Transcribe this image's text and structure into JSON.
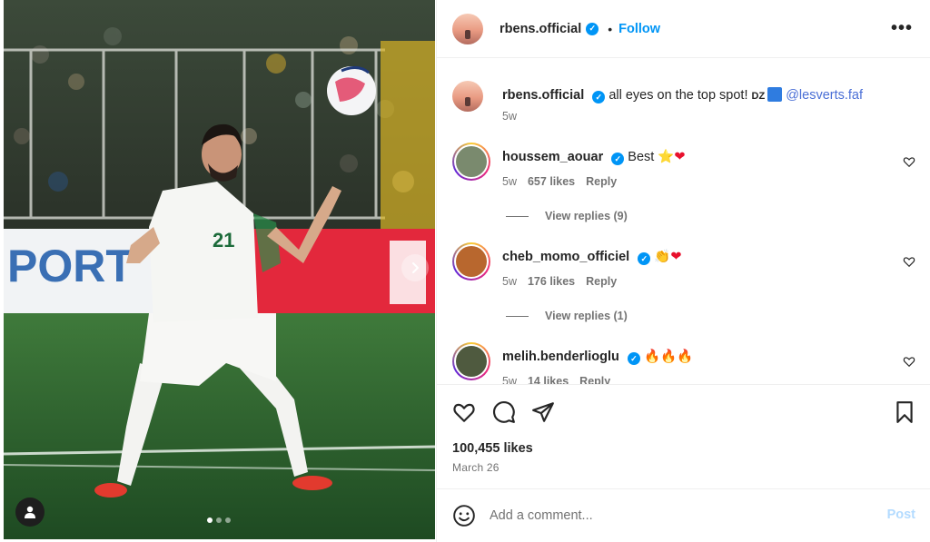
{
  "post": {
    "owner": "rbens.official",
    "follow_label": "Follow",
    "separator": "•",
    "more_label": "•••",
    "caption": {
      "username": "rbens.official",
      "text": "all eyes on the top spot! ",
      "flag_text": "DZ",
      "mention": "@lesverts.faf",
      "time": "5w"
    },
    "likes": "100,455 likes",
    "date": "March 26",
    "media": {
      "background_text": "PORT",
      "jersey_number": "21",
      "slide_count": 3,
      "active_slide": 1
    }
  },
  "comments": [
    {
      "username": "houssem_aouar",
      "text": "Best ",
      "emoji": [
        "⭐",
        "❤"
      ],
      "time": "5w",
      "likes": "657 likes",
      "reply_label": "Reply",
      "view_replies": "View replies (9)",
      "avatar_color": "#7a8a6e"
    },
    {
      "username": "cheb_momo_officiel",
      "text": "",
      "emoji": [
        "👏",
        "❤"
      ],
      "time": "5w",
      "likes": "176 likes",
      "reply_label": "Reply",
      "view_replies": "View replies (1)",
      "avatar_color": "#b8672e"
    },
    {
      "username": "melih.benderlioglu",
      "text": "",
      "emoji": [
        "🔥",
        "🔥",
        "🔥"
      ],
      "time": "5w",
      "likes": "14 likes",
      "reply_label": "Reply",
      "view_replies": "",
      "avatar_color": "#4f5a3f"
    }
  ],
  "comment_box": {
    "placeholder": "Add a comment...",
    "post_label": "Post"
  },
  "colors": {
    "accent": "#0095f6",
    "muted": "#737373",
    "post_disabled": "#b3dbff"
  },
  "icons": {
    "like": "heart-icon",
    "comment": "comment-icon",
    "share": "share-icon",
    "save": "bookmark-icon",
    "emoji": "smiley-icon",
    "more": "more-icon",
    "next": "chevron-right-icon",
    "tagged_user": "person-icon"
  }
}
